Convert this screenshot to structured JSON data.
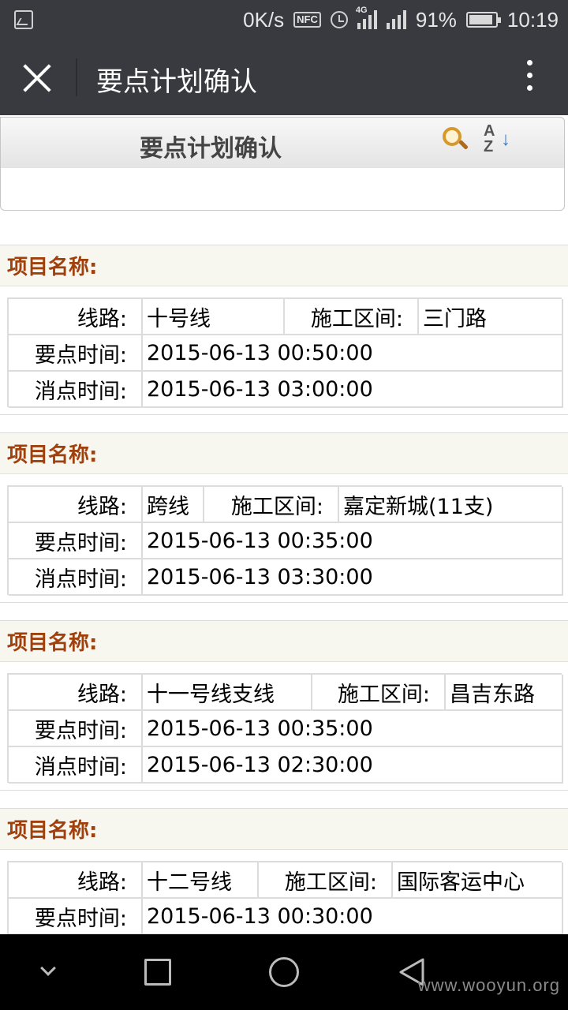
{
  "status_bar": {
    "speed": "0K/s",
    "nfc": "NFC",
    "network": "4G",
    "battery_level": 91,
    "battery": "91%",
    "time": "10:19"
  },
  "title_bar": {
    "title": "要点计划确认",
    "close_icon": "close-icon",
    "more_icon": "more-vertical-icon"
  },
  "page_header": {
    "title": "要点计划确认",
    "search_icon": "search-icon",
    "sort_icon": "sort-az-icon",
    "sort_a": "A",
    "sort_z": "Z",
    "sort_arrow": "↓"
  },
  "labels": {
    "project_name": "项目名称:",
    "line": "线路:",
    "section": "施工区间:",
    "start_time": "要点时间:",
    "end_time": "消点时间:"
  },
  "records": [
    {
      "line": "十号线",
      "section": "三门路",
      "start_time": "2015-06-13 00:50:00",
      "end_time": "2015-06-13 03:00:00"
    },
    {
      "line": "跨线",
      "section": "嘉定新城(11支)",
      "start_time": "2015-06-13 00:35:00",
      "end_time": "2015-06-13 03:30:00"
    },
    {
      "line": "十一号线支线",
      "section": "昌吉东路",
      "start_time": "2015-06-13 00:35:00",
      "end_time": "2015-06-13 02:30:00"
    },
    {
      "line": "十二号线",
      "section": "国际客运中心",
      "start_time": "2015-06-13 00:30:00",
      "end_time": ""
    }
  ],
  "watermark": "www.wooyun.org"
}
